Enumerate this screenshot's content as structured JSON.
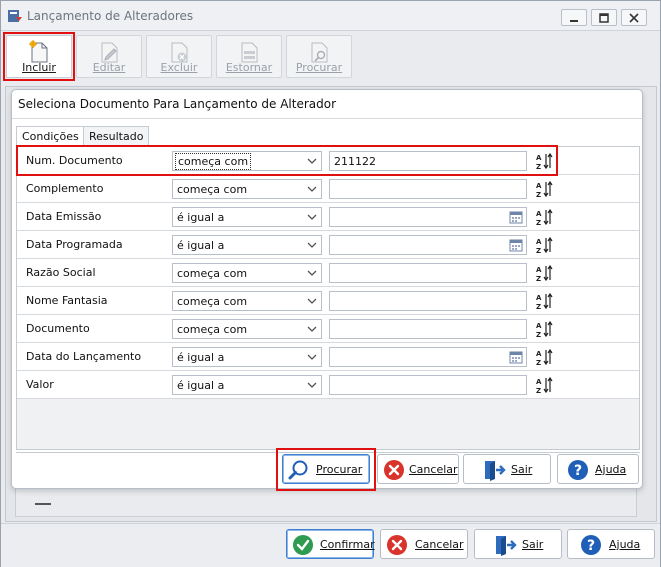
{
  "window": {
    "title": "Lançamento de Alteradores"
  },
  "toolbar": {
    "buttons": [
      {
        "label": "Incluir",
        "icon": "new-document-icon",
        "enabled": true
      },
      {
        "label": "Editar",
        "icon": "edit-document-icon",
        "enabled": false
      },
      {
        "label": "Excluir",
        "icon": "delete-document-icon",
        "enabled": false
      },
      {
        "label": "Estornar",
        "icon": "reverse-icon",
        "enabled": false
      },
      {
        "label": "Procurar",
        "icon": "search-document-icon",
        "enabled": false
      }
    ]
  },
  "dialog": {
    "title": "Seleciona Documento Para Lançamento de Alterador",
    "tabs": [
      {
        "label": "Condições",
        "active": true
      },
      {
        "label": "Resultado",
        "active": false
      }
    ],
    "rows": [
      {
        "field": "Num. Documento",
        "operator": "começa com",
        "value": "211122",
        "has_calendar": false
      },
      {
        "field": "Complemento",
        "operator": "começa com",
        "value": "",
        "has_calendar": false
      },
      {
        "field": "Data Emissão",
        "operator": "é igual a",
        "value": "",
        "has_calendar": true
      },
      {
        "field": "Data Programada",
        "operator": "é igual a",
        "value": "",
        "has_calendar": true
      },
      {
        "field": "Razão Social",
        "operator": "começa com",
        "value": "",
        "has_calendar": false
      },
      {
        "field": "Nome Fantasia",
        "operator": "começa com",
        "value": "",
        "has_calendar": false
      },
      {
        "field": "Documento",
        "operator": "começa com",
        "value": "",
        "has_calendar": false
      },
      {
        "field": "Data do Lançamento",
        "operator": "é igual a",
        "value": "",
        "has_calendar": true
      },
      {
        "field": "Valor",
        "operator": "é igual a",
        "value": "",
        "has_calendar": false
      }
    ],
    "buttons": {
      "search": "Procurar",
      "cancel": "Cancelar",
      "exit": "Sair",
      "help": "Ajuda"
    }
  },
  "bottom": {
    "confirm": "Confirmar",
    "cancel": "Cancelar",
    "exit": "Sair",
    "help": "Ajuda"
  },
  "colors": {
    "highlight": "#e01010",
    "accent": "#3d7fd1",
    "help_blue": "#1f5fb8",
    "cancel_red": "#d9342b",
    "confirm_green": "#2e9b4f"
  }
}
